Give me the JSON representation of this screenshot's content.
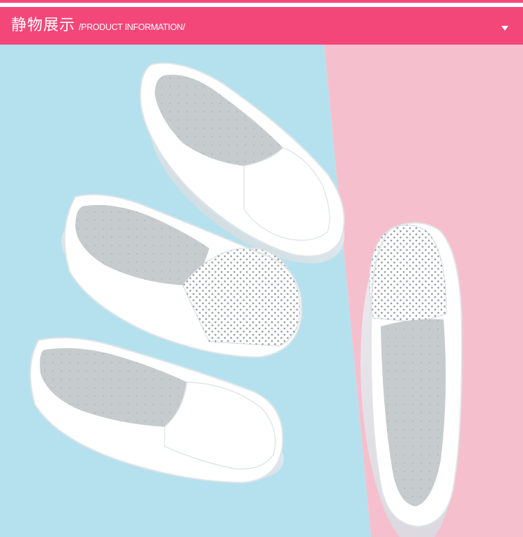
{
  "banner": {
    "title": "静物展示",
    "subtitle": "/PRODUCT INFORMATION/",
    "accent_color": "#f3477a",
    "arrow_icon": "chevron-down-icon"
  },
  "photo": {
    "background_colors": [
      "#b5e1ee",
      "#f6bfcd"
    ],
    "product_color": "#ffffff"
  }
}
